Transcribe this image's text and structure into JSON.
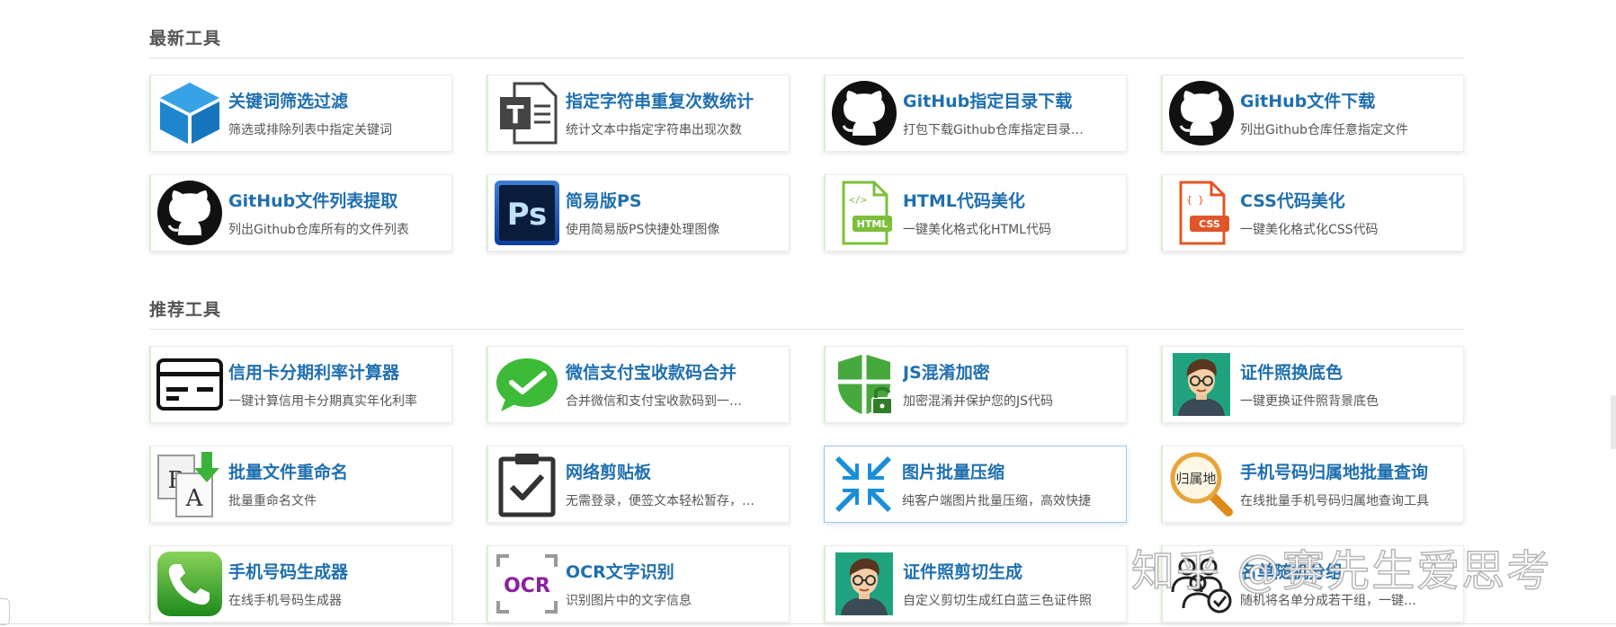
{
  "sections": [
    {
      "title": "最新工具",
      "tools": [
        {
          "title": "关键词筛选过滤",
          "desc": "筛选或排除列表中指定关键词",
          "icon": "cube-icon"
        },
        {
          "title": "指定字符串重复次数统计",
          "desc": "统计文本中指定字符串出现次数",
          "icon": "text-document-icon"
        },
        {
          "title": "GitHub指定目录下载",
          "desc": "打包下载Github仓库指定目录…",
          "icon": "github-icon"
        },
        {
          "title": "GitHub文件下载",
          "desc": "列出Github仓库任意指定文件",
          "icon": "github-icon"
        },
        {
          "title": "GitHub文件列表提取",
          "desc": "列出Github仓库所有的文件列表",
          "icon": "github-icon"
        },
        {
          "title": "简易版PS",
          "desc": "使用简易版PS快捷处理图像",
          "icon": "photoshop-icon",
          "icon_text": "Ps"
        },
        {
          "title": "HTML代码美化",
          "desc": "一键美化格式化HTML代码",
          "icon": "html-file-icon",
          "icon_text": "HTML"
        },
        {
          "title": "CSS代码美化",
          "desc": "一键美化格式化CSS代码",
          "icon": "css-file-icon",
          "icon_text": "CSS"
        }
      ]
    },
    {
      "title": "推荐工具",
      "tools": [
        {
          "title": "信用卡分期利率计算器",
          "desc": "一键计算信用卡分期真实年化利率",
          "icon": "credit-card-icon"
        },
        {
          "title": "微信支付宝收款码合并",
          "desc": "合并微信和支付宝收款码到一…",
          "icon": "wechat-icon"
        },
        {
          "title": "JS混淆加密",
          "desc": "加密混淆并保护您的JS代码",
          "icon": "shield-lock-icon"
        },
        {
          "title": "证件照换底色",
          "desc": "一键更换证件照背景底色",
          "icon": "avatar-icon"
        },
        {
          "title": "批量文件重命名",
          "desc": "批量重命名文件",
          "icon": "batch-rename-icon"
        },
        {
          "title": "网络剪贴板",
          "desc": "无需登录，便签文本轻松暂存，…",
          "icon": "clipboard-check-icon"
        },
        {
          "title": "图片批量压缩",
          "desc": "纯客户端图片批量压缩，高效快捷",
          "icon": "compress-arrows-icon",
          "active": true
        },
        {
          "title": "手机号码归属地批量查询",
          "desc": "在线批量手机号码归属地查询工具",
          "icon": "magnifier-location-icon",
          "icon_text": "归属地"
        },
        {
          "title": "手机号码生成器",
          "desc": "在线手机号码生成器",
          "icon": "phone-icon"
        },
        {
          "title": "OCR文字识别",
          "desc": "识别图片中的文字信息",
          "icon": "ocr-icon",
          "icon_text": "OCR"
        },
        {
          "title": "证件照剪切生成",
          "desc": "自定义剪切生成红白蓝三色证件照",
          "icon": "avatar-icon"
        },
        {
          "title": "名单随机分组",
          "desc": "随机将名单分成若干组，一键…",
          "icon": "group-icon"
        }
      ]
    }
  ],
  "watermark": "知乎 @赛先生爱思考",
  "colors": {
    "title_blue": "#1f6fb0",
    "card_border_green": "#d6f2d0",
    "active_border": "#9ec3e6"
  }
}
